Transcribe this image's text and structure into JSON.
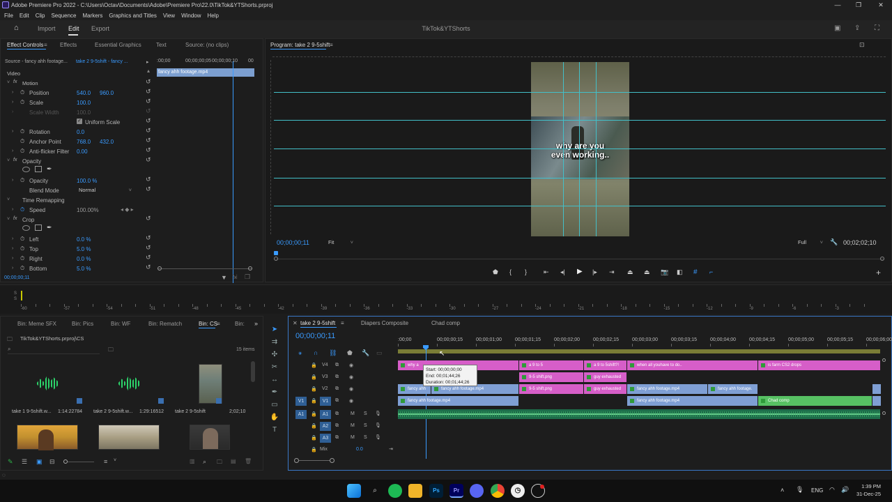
{
  "window": {
    "title": "Adobe Premiere Pro 2022 - C:\\Users\\Octav\\Documents\\Adobe\\Premiere Pro\\22.0\\TikTok&YTShorts.prproj"
  },
  "menu": [
    "File",
    "Edit",
    "Clip",
    "Sequence",
    "Markers",
    "Graphics and Titles",
    "View",
    "Window",
    "Help"
  ],
  "workspace": {
    "tabs": [
      "Import",
      "Edit",
      "Export"
    ],
    "active": "Edit",
    "project": "TikTok&YTShorts"
  },
  "effect_panel": {
    "tabs": [
      "Effect Controls",
      "Effects",
      "Essential Graphics",
      "Text",
      "Source: (no clips)"
    ],
    "source_label": "Source - fancy ahh footage...",
    "seq_label": "take 2 9-5shift - fancy ...",
    "ruler": [
      ":00;00",
      "00;00;00;05",
      "00;00;00;10",
      "00"
    ],
    "clip_bar": "fancy ahh footage.mp4",
    "section_video": "Video",
    "motion": "Motion",
    "rows": [
      {
        "label": "Position",
        "v1": "540.0",
        "v2": "960.0"
      },
      {
        "label": "Scale",
        "v1": "100.0",
        "v2": ""
      },
      {
        "label": "Scale Width",
        "v1": "100.0",
        "v2": ""
      },
      {
        "label": "Uniform Scale",
        "v1": "",
        "v2": ""
      },
      {
        "label": "Rotation",
        "v1": "0.0",
        "v2": ""
      },
      {
        "label": "Anchor Point",
        "v1": "768.0",
        "v2": "432.0"
      },
      {
        "label": "Anti-flicker Filter",
        "v1": "0.00",
        "v2": ""
      }
    ],
    "opacity": "Opacity",
    "opacity_val": "100.0 %",
    "blend_label": "Blend Mode",
    "blend_val": "Normal",
    "time_remap": "Time Remapping",
    "speed_label": "Speed",
    "speed_val": "100.00%",
    "crop": "Crop",
    "crop_rows": [
      {
        "label": "Left",
        "v": "0.0 %"
      },
      {
        "label": "Top",
        "v": "5.0 %"
      },
      {
        "label": "Right",
        "v": "0.0 %"
      },
      {
        "label": "Bottom",
        "v": "5.0 %"
      }
    ],
    "timecode": "00;00;00;11"
  },
  "program": {
    "title": "Program: take 2 9-5shift",
    "timecode": "00;00;00;11",
    "fit": "Fit",
    "full": "Full",
    "duration": "00;02;02;10",
    "caption_line1": "why are you",
    "caption_line2": "even working.."
  },
  "meter_labels": [
    "dB",
    "-57",
    "-54",
    "-51",
    "-48",
    "-45",
    "-42",
    "-39",
    "-36",
    "-33",
    "-30",
    "-27",
    "-24",
    "-21",
    "-18",
    "-15",
    "-12",
    "-9",
    "-6",
    "-3",
    "0"
  ],
  "meter_db": [
    "-60",
    "-57",
    "-54",
    "-51",
    "-48",
    "-45",
    "-42",
    "-39",
    "-36",
    "-33",
    "-30",
    "-27",
    "-24",
    "-21",
    "-18",
    "-15",
    "-12",
    "-9",
    "-6",
    "-3"
  ],
  "project": {
    "tabs": [
      "Bin: Meme SFX",
      "Bin: Pics",
      "Bin: WF",
      "Bin: Rematch",
      "Bin: CS",
      "Bin:"
    ],
    "path": "TikTok&YTShorts.prproj\\CS",
    "items_count": "15 items",
    "items": [
      {
        "name": "take 1 9-5shift.w...",
        "dur": "1:14:22784"
      },
      {
        "name": "take 2 9-5shift.w...",
        "dur": "1:29:16512"
      },
      {
        "name": "take 2 9-5shift",
        "dur": "2;02;10"
      }
    ]
  },
  "timeline": {
    "tabs": [
      "take 2 9-5shift",
      "Diapers Composite",
      "Chad comp"
    ],
    "timecode": "00;00;00;11",
    "ruler": [
      ":00;00",
      "00;00;00;15",
      "00;00;01;00",
      "00;00;01;15",
      "00;00;02;00",
      "00;00;02;15",
      "00;00;03;00",
      "00;00;03;15",
      "00;00;04;00",
      "00;00;04;15",
      "00;00;05;00",
      "00;00;05;15",
      "00;00;06;00"
    ],
    "tracks": [
      {
        "name": "V4"
      },
      {
        "name": "V3"
      },
      {
        "name": "V2"
      },
      {
        "name": "V1"
      },
      {
        "name": "A1"
      },
      {
        "name": "A2"
      },
      {
        "name": "A3"
      }
    ],
    "mix_label": "Mix",
    "mix_val": "0.0",
    "tooltip": {
      "start": "Start: 00;00;00;00",
      "end": "End: 00;01;44;26",
      "duration": "Duration: 00;01;44;26"
    },
    "clips": {
      "v4": [
        {
          "name": "why a"
        },
        {
          "name": "a 9 to 5"
        },
        {
          "name": "a 9 to 5shift?!"
        },
        {
          "name": "when all youhave to do.."
        },
        {
          "name": "is farm CS2 drops"
        }
      ],
      "v3": [
        {
          "name": "9-5 shift.png"
        },
        {
          "name": "guy exhausted"
        }
      ],
      "v2": [
        {
          "name": "fancy ahh"
        },
        {
          "name": "fancy ahh footage.mp4"
        },
        {
          "name": "9-5 shift.png"
        },
        {
          "name": "guy exhausted"
        },
        {
          "name": "fancy ahh footage.mp4"
        },
        {
          "name": "fancy ahh footage."
        }
      ],
      "v1": [
        {
          "name": "fancy ahh footage.mp4"
        },
        {
          "name": "fancy ahh footage.mp4"
        },
        {
          "name": "Chad comp"
        }
      ]
    }
  },
  "taskbar": {
    "lang": "ENG",
    "time": "1:39 PM",
    "date": "31-Dec-25"
  }
}
